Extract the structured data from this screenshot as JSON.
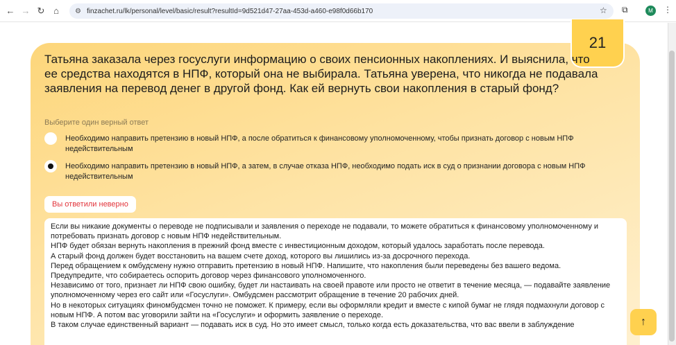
{
  "browser": {
    "url": "finzachet.ru/lk/personal/level/basic/result?resultId=9d521d47-27aa-453d-a460-e98f0d66b170",
    "avatar": "M"
  },
  "question": {
    "number": "21",
    "text": "Татьяна заказала через госуслуги информацию о своих пенсионных накоплениях. И выяснила, что ее средства находятся в НПФ, который она не выбирала. Татьяна уверена, что никогда не подавала заявления на перевод денег в другой фонд. Как ей вернуть свои накопления в старый фонд?",
    "hint": "Выберите один верный ответ"
  },
  "options": [
    {
      "text": "Необходимо направить претензию в новый НПФ, а после обратиться к финансовому уполномоченному, чтобы признать договор с новым НПФ недействительным",
      "selected": false
    },
    {
      "text": "Необходимо направить претензию в новый НПФ, а затем, в случае отказа НПФ, необходимо подать иск в суд о признании договора с новым НПФ недействительным",
      "selected": true
    }
  ],
  "result": {
    "label": "Вы ответили неверно",
    "color": "#e2343b"
  },
  "explanation": [
    "Если вы никакие документы о переводе не подписывали и заявления о переходе не подавали, то можете обратиться к финансовому уполномоченному и потребовать признать договор с новым НПФ недействительным.",
    "НПФ будет обязан вернуть накопления в прежний фонд вместе с инвестиционным доходом, который удалось заработать после перевода.",
    "А старый фонд должен будет восстановить на вашем счете доход, которого вы лишились из-за досрочного перехода.",
    "Перед обращением к омбудсмену нужно отправить претензию в новый НПФ. Напишите, что накопления были переведены без вашего ведома.",
    "Предупредите, что собираетесь оспорить договор через финансового уполномоченного.",
    "Независимо от того, признает ли НПФ свою ошибку, будет ли настаивать на своей правоте или просто не ответит в течение месяца, — подавайте заявление уполномоченному через его сайт или «Госуслуги». Омбудсмен рассмотрит обращение в течение 20 рабочих дней.",
    "Но в некоторых ситуациях финомбудсмен точно не поможет. К примеру, если вы оформляли кредит и вместе с кипой бумаг не глядя подмахнули договор с новым НПФ. А потом вас уговорили зайти на «Госуслуги» и оформить заявление о переходе.",
    "В таком случае единственный вариант — подавать иск в суд. Но это имеет смысл, только когда есть доказательства, что вас ввели в заблуждение"
  ]
}
